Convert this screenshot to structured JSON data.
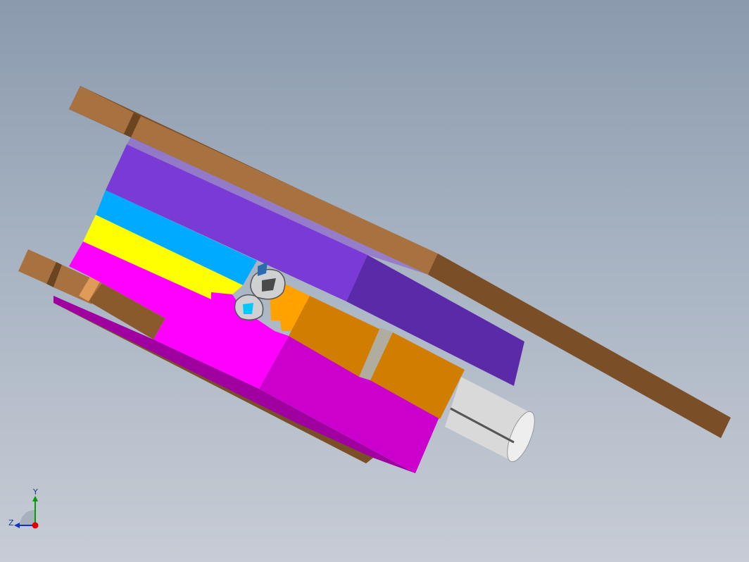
{
  "viewport": {
    "background_top": "#8b9aae",
    "background_bottom": "#c7ccd5"
  },
  "model": {
    "part_colors": {
      "plate": "#a06a38",
      "plate_dark": "#7a4f28",
      "purple": "#7a3ad6",
      "purple_dark": "#5a2aa8",
      "cyan": "#00aaff",
      "yellow": "#ffff00",
      "magenta": "#ff00ff",
      "magenta_dark": "#cc00cc",
      "orange": "#d17e00",
      "orange_light": "#ffa200",
      "cylinder": "#d9d9d9"
    }
  },
  "triad": {
    "y_label": "Y",
    "z_label": "Z",
    "x_axis_color": "#e00000",
    "y_axis_color": "#00a000",
    "z_axis_color": "#1030d0",
    "icon": "coordinate-triad-icon"
  }
}
